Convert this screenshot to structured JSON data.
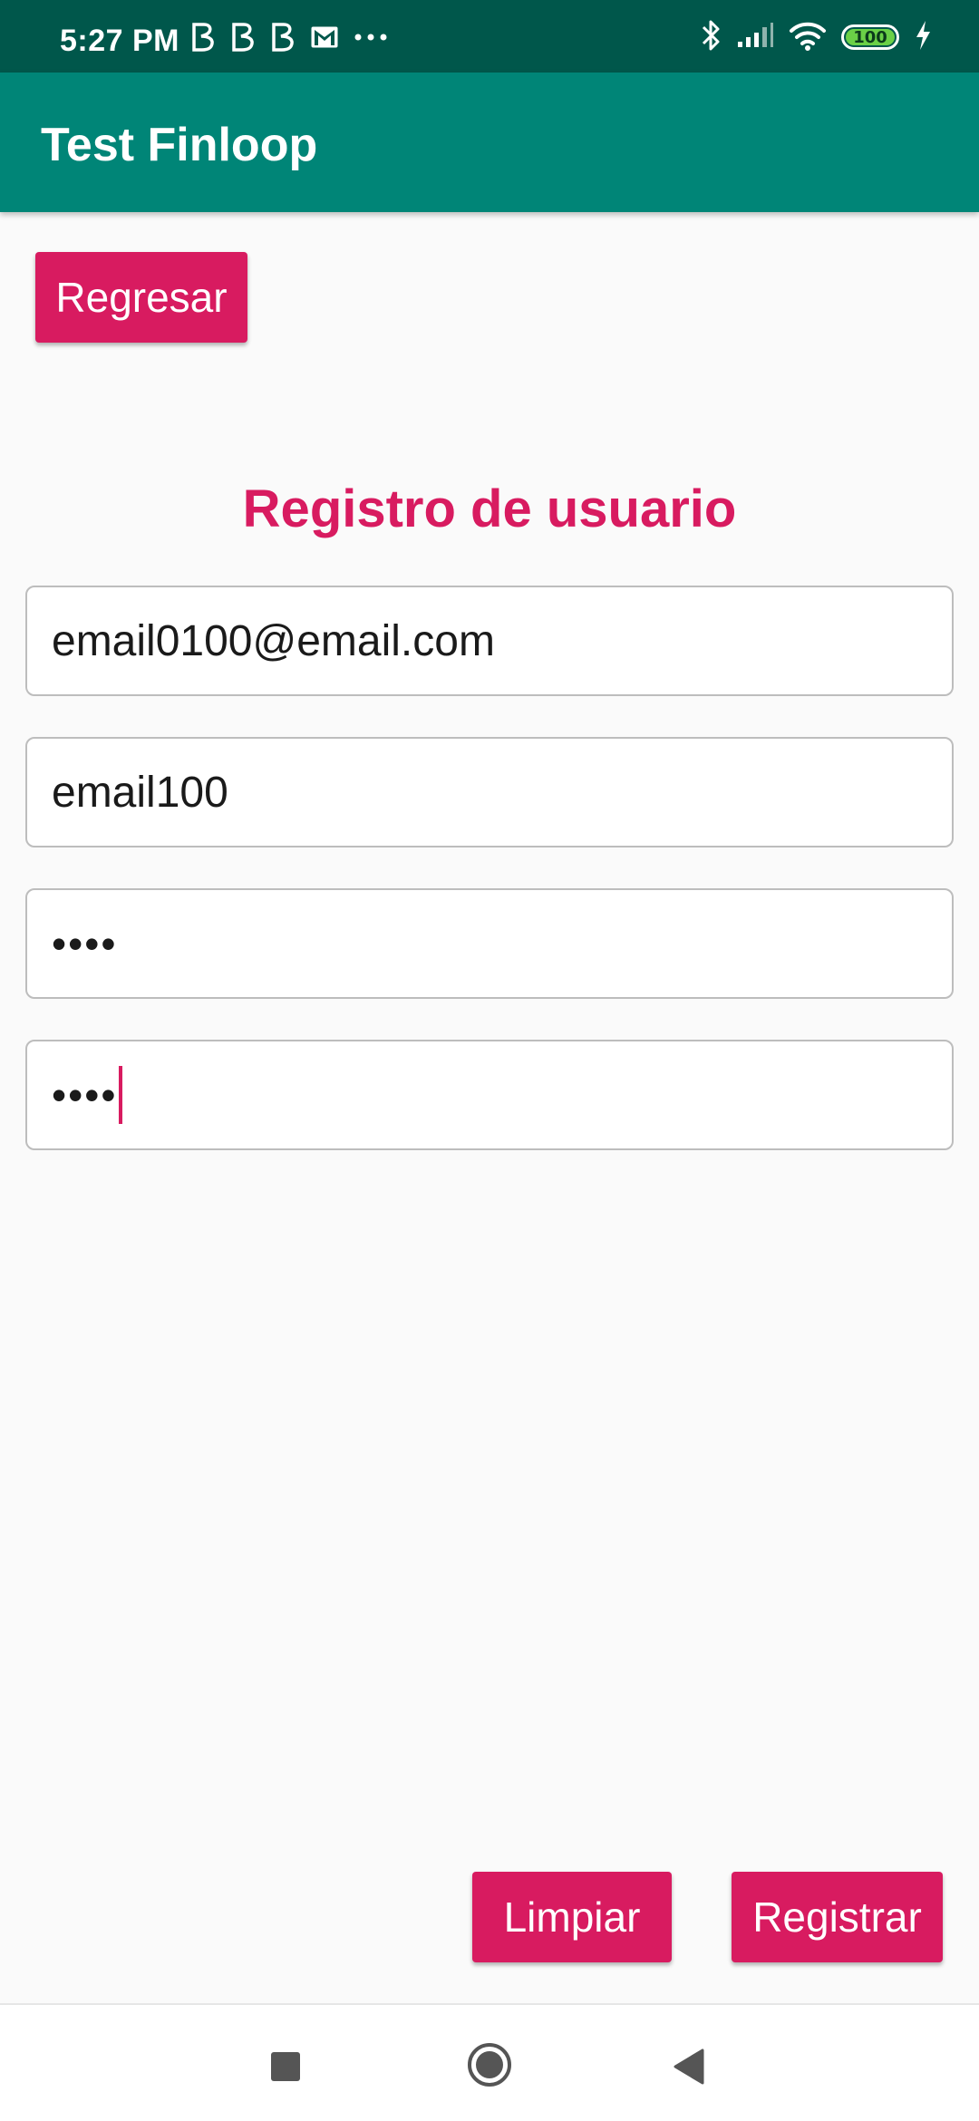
{
  "status_bar": {
    "time": "5:27 PM",
    "notification_icons": [
      "b-icon",
      "b-icon",
      "b-icon",
      "gmail-icon",
      "more-dots-icon"
    ],
    "right_icons": [
      "bluetooth-icon",
      "cell-signal-icon",
      "wifi-icon",
      "battery-icon",
      "charging-bolt-icon"
    ],
    "battery_level": 100,
    "battery_text": "100"
  },
  "app_bar": {
    "title": "Test Finloop"
  },
  "buttons": {
    "back_label": "Regresar",
    "clear_label": "Limpiar",
    "register_label": "Registrar"
  },
  "form": {
    "title": "Registro de usuario",
    "email_value": "email0100@email.com",
    "username_value": "email100",
    "password_value": "••••",
    "confirm_password_value": "••••"
  },
  "colors": {
    "status_bar": "#00574b",
    "app_bar": "#008577",
    "accent": "#d81b60",
    "background": "#fafafa"
  },
  "nav_bar": {
    "icons": [
      "recent-apps-icon",
      "home-icon",
      "back-icon"
    ]
  }
}
